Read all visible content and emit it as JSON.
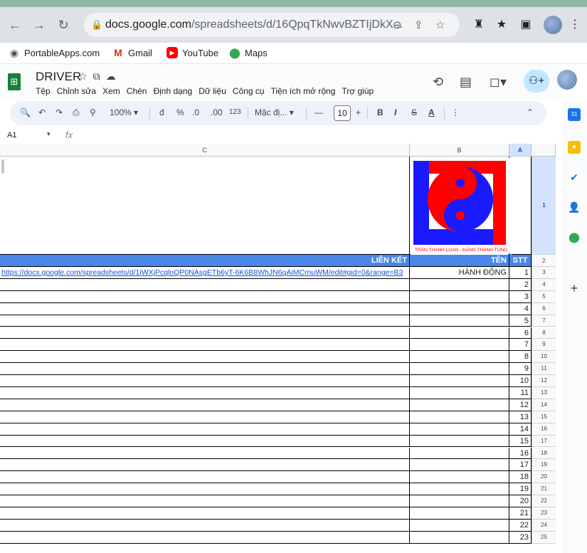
{
  "browser": {
    "url_host": "docs.google.com",
    "url_path": "/spreadsheets/d/16QpqTkNwvBZTIjDkX...",
    "bookmarks": [
      {
        "label": "PortableApps.com",
        "icon": "portableapps-icon"
      },
      {
        "label": "Gmail",
        "icon": "gmail-icon"
      },
      {
        "label": "YouTube",
        "icon": "youtube-icon"
      },
      {
        "label": "Maps",
        "icon": "maps-icon"
      }
    ]
  },
  "sheets": {
    "title": "DRIVER",
    "menu": [
      "Tệp",
      "Chỉnh sửa",
      "Xem",
      "Chèn",
      "Định dạng",
      "Dữ liệu",
      "Công cụ",
      "Tiện ích mở rộng",
      "Trợ giúp"
    ],
    "toolbar": {
      "zoom": "100%",
      "currency": "đ",
      "percent": "%",
      "dec_decrease": ".0",
      "dec_increase": ".00",
      "number_format": "123",
      "font": "Mặc đị...",
      "font_size": "10",
      "bold": "B",
      "italic": "I",
      "strike": "S",
      "text_color": "A"
    },
    "cell_ref": "A1",
    "fx": "fx"
  },
  "grid": {
    "columns": [
      {
        "label": "C"
      },
      {
        "label": "B"
      },
      {
        "label": "A"
      }
    ],
    "row_numbers": [
      "1",
      "2",
      "3",
      "4",
      "5",
      "6",
      "7",
      "8",
      "9",
      "10",
      "11",
      "12",
      "13",
      "14",
      "15",
      "16",
      "17",
      "18",
      "19",
      "20",
      "21",
      "22",
      "23",
      "24",
      "25"
    ],
    "header": {
      "col_c": "LIÊN KẾT",
      "col_b": "TÊN",
      "col_a": "STT"
    },
    "logo_caption": "TRẦN THANH LOAN - ĐẶNG THANH TÙNG",
    "rows": [
      {
        "link": "https://docs.google.com/spreadsheets/d/1iWXjPcqlnQP0NAsgETb6yT-6K6B8WhJN6qAiMCrnuWM/edit#gid=0&range=B3",
        "name": "HÀNH ĐỘNG",
        "stt": "1"
      },
      {
        "link": "",
        "name": "",
        "stt": "2"
      },
      {
        "link": "",
        "name": "",
        "stt": "3"
      },
      {
        "link": "",
        "name": "",
        "stt": "4"
      },
      {
        "link": "",
        "name": "",
        "stt": "5"
      },
      {
        "link": "",
        "name": "",
        "stt": "6"
      },
      {
        "link": "",
        "name": "",
        "stt": "7"
      },
      {
        "link": "",
        "name": "",
        "stt": "8"
      },
      {
        "link": "",
        "name": "",
        "stt": "9"
      },
      {
        "link": "",
        "name": "",
        "stt": "10"
      },
      {
        "link": "",
        "name": "",
        "stt": "11"
      },
      {
        "link": "",
        "name": "",
        "stt": "12"
      },
      {
        "link": "",
        "name": "",
        "stt": "13"
      },
      {
        "link": "",
        "name": "",
        "stt": "14"
      },
      {
        "link": "",
        "name": "",
        "stt": "15"
      },
      {
        "link": "",
        "name": "",
        "stt": "16"
      },
      {
        "link": "",
        "name": "",
        "stt": "17"
      },
      {
        "link": "",
        "name": "",
        "stt": "18"
      },
      {
        "link": "",
        "name": "",
        "stt": "19"
      },
      {
        "link": "",
        "name": "",
        "stt": "20"
      },
      {
        "link": "",
        "name": "",
        "stt": "21"
      },
      {
        "link": "",
        "name": "",
        "stt": "22"
      },
      {
        "link": "",
        "name": "",
        "stt": "23"
      }
    ]
  },
  "colors": {
    "header_blue": "#4a86e8",
    "link": "#1155cc",
    "sheets_green": "#188038"
  }
}
